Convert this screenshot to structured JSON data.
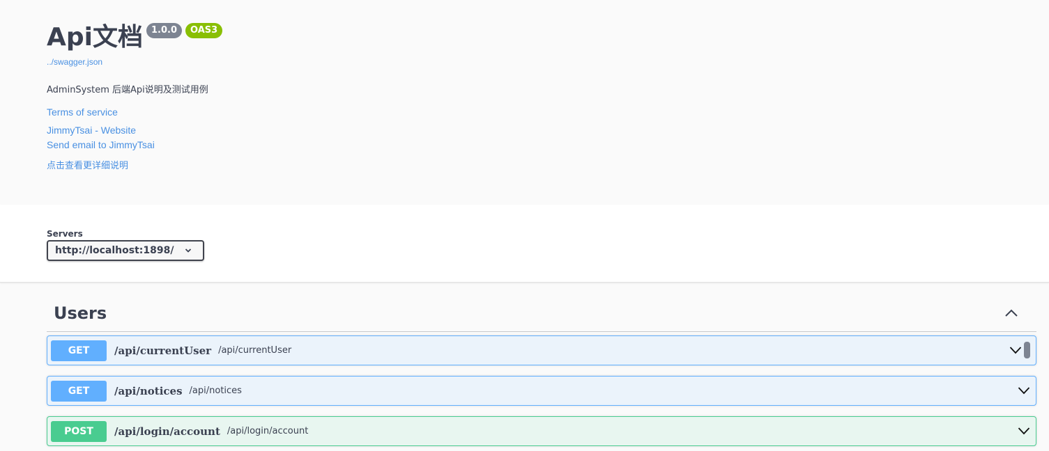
{
  "info": {
    "title": "Api文档",
    "version": "1.0.0",
    "oas": "OAS3",
    "spec_url": "../swagger.json",
    "description": "AdminSystem 后端Api说明及测试用例",
    "terms": "Terms of service",
    "website": "JimmyTsai - Website",
    "email": "Send email to JimmyTsai",
    "more": "点击查看更详细说明"
  },
  "servers": {
    "label": "Servers",
    "selected": "http://localhost:1898/"
  },
  "tag": {
    "name": "Users"
  },
  "operations": [
    {
      "method": "GET",
      "path": "/api/currentUser",
      "summary": "/api/currentUser"
    },
    {
      "method": "GET",
      "path": "/api/notices",
      "summary": "/api/notices"
    },
    {
      "method": "POST",
      "path": "/api/login/account",
      "summary": "/api/login/account"
    }
  ],
  "colors": {
    "get": "#61affe",
    "post": "#49cc90",
    "link": "#4990e2",
    "version_badge": "#7d8492",
    "oas_badge": "#89bf04"
  },
  "icons": {
    "server_dropdown": "chevron-down-icon",
    "tag_toggle": "chevron-up-icon",
    "operation_toggle": "chevron-down-icon",
    "auth": "lock-icon"
  }
}
